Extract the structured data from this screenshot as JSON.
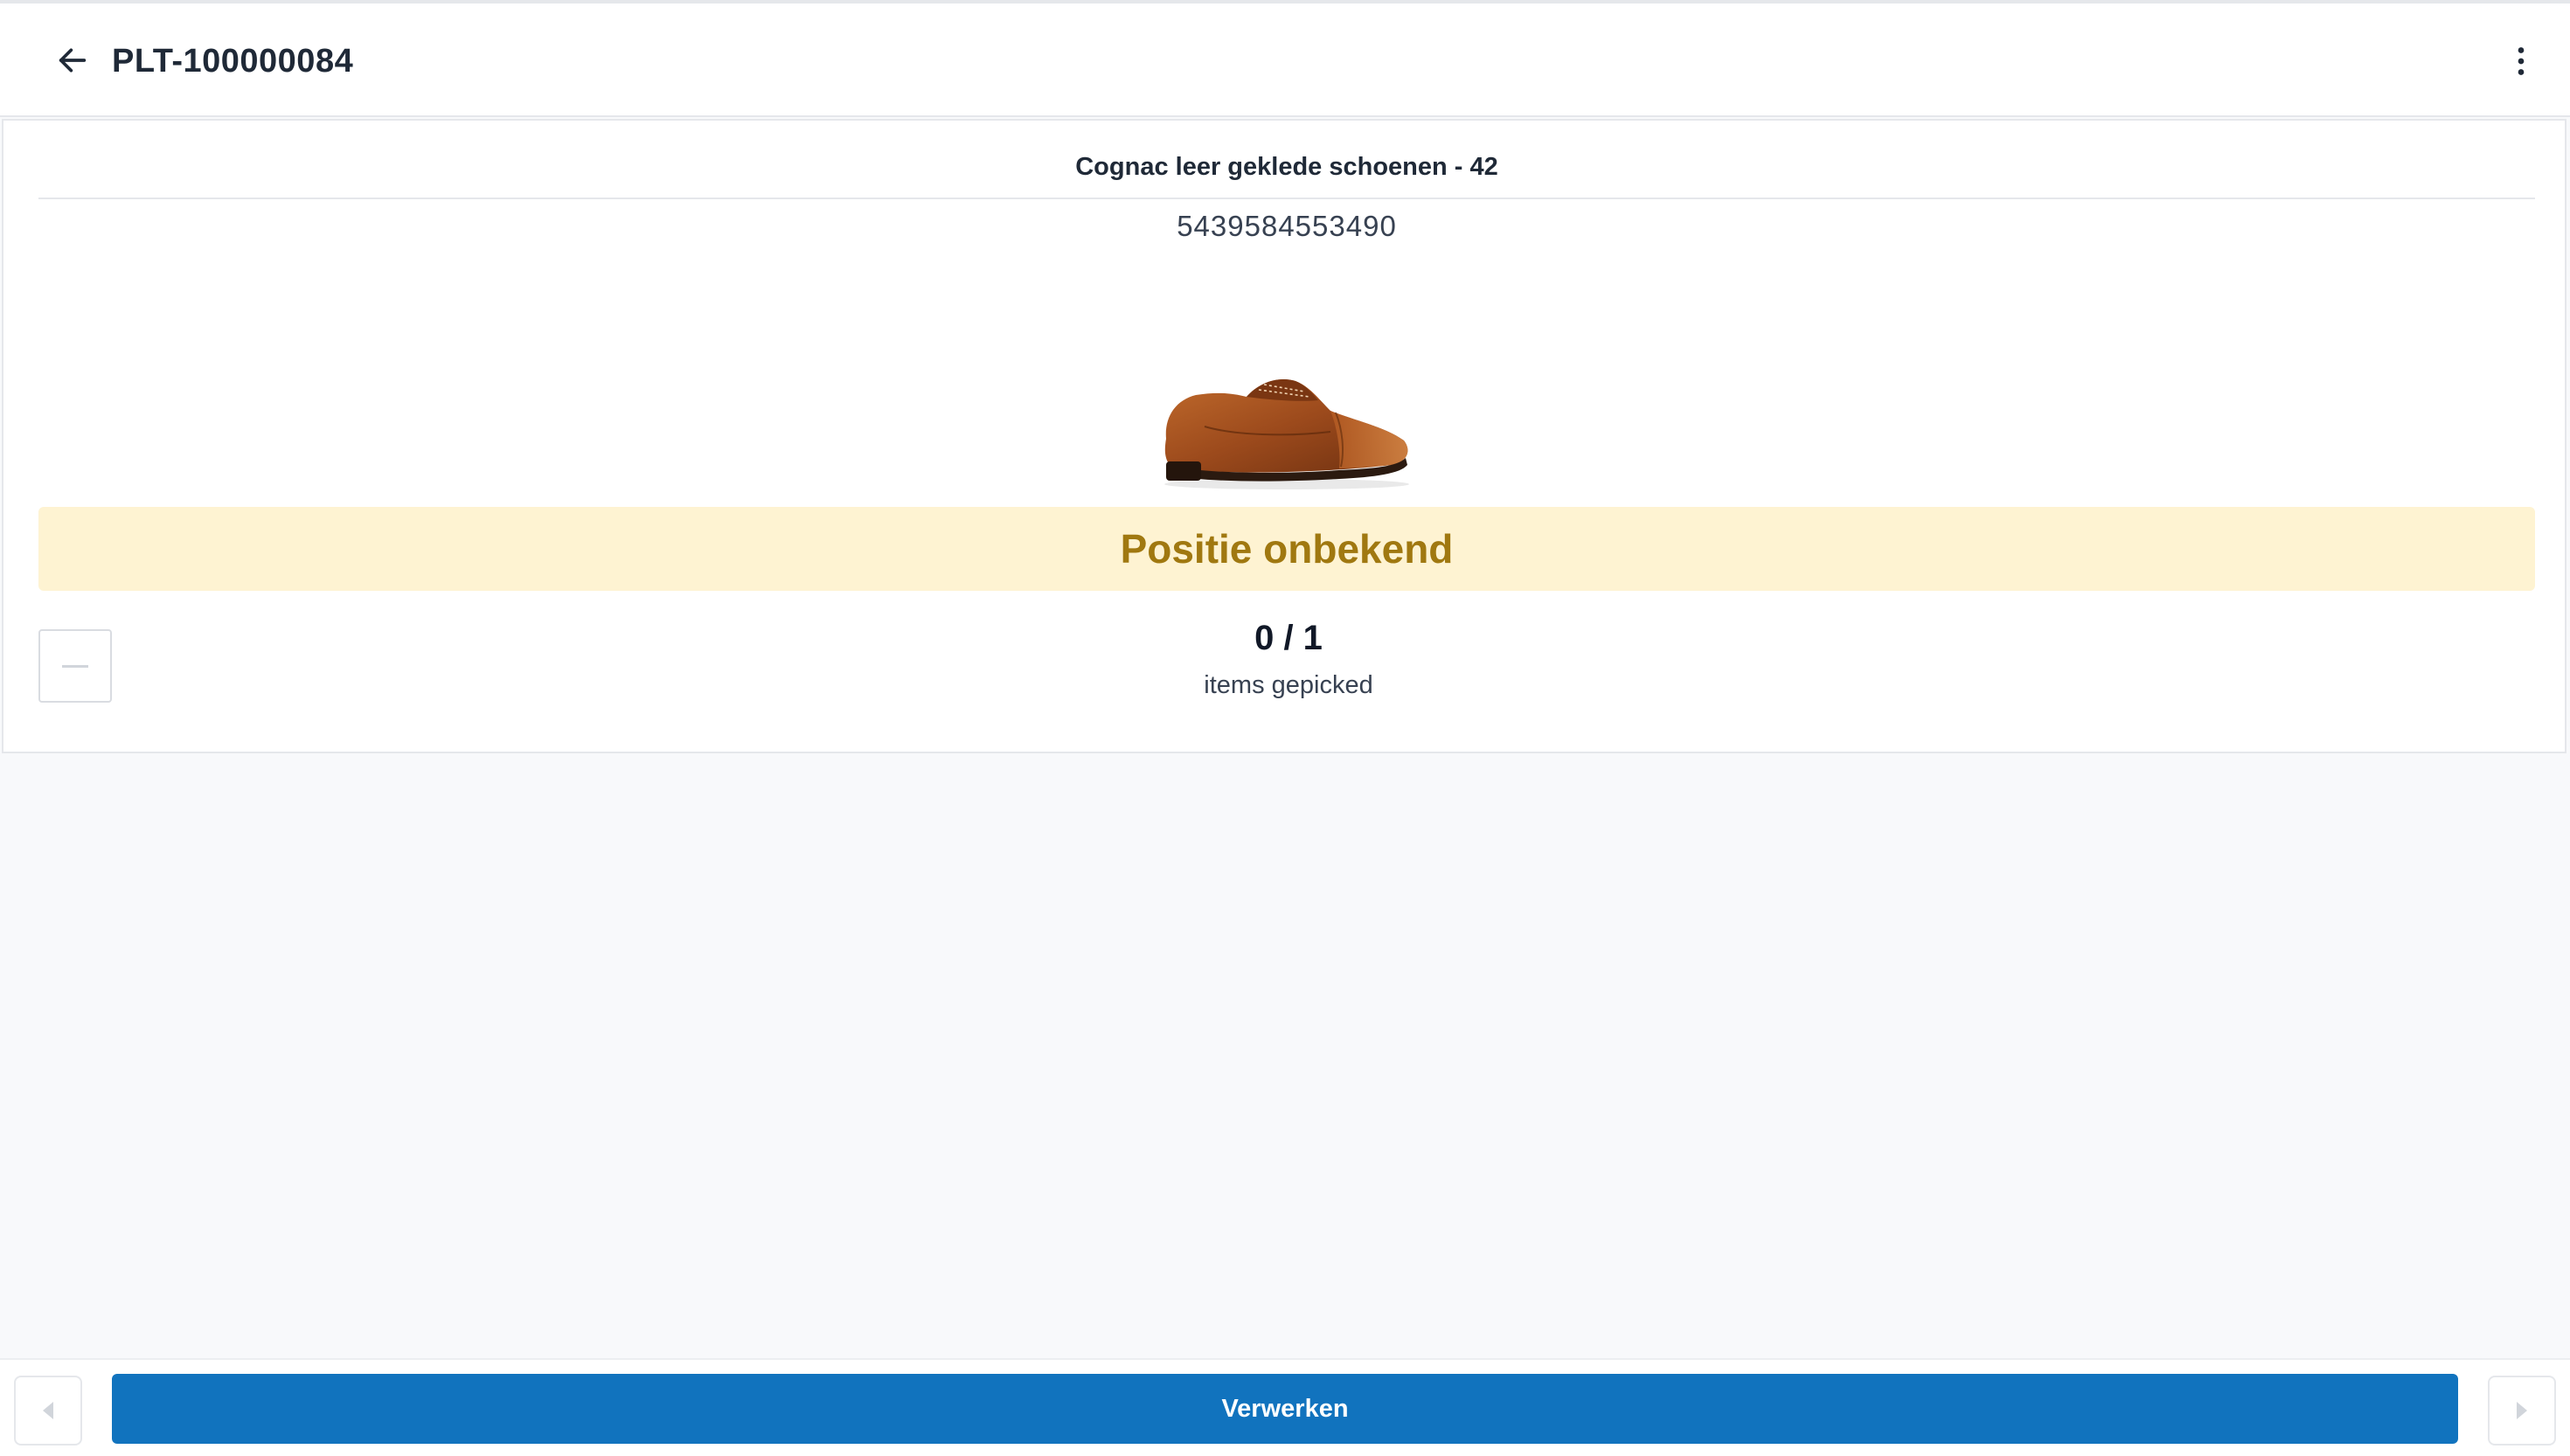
{
  "header": {
    "title": "PLT-100000084",
    "back_icon": "arrow-left-icon",
    "menu_icon": "more-vertical-icon"
  },
  "product": {
    "name": "Cognac leer geklede schoenen - 42",
    "barcode": "5439584553490",
    "image": "cognac-leather-oxford-shoe"
  },
  "position": {
    "label": "Positie onbekend"
  },
  "picking": {
    "count": "0 / 1",
    "label": "items gepicked",
    "decrement_icon": "minus-icon"
  },
  "footer": {
    "process_label": "Verwerken",
    "prev_icon": "caret-left-icon",
    "next_icon": "caret-right-icon"
  },
  "colors": {
    "primary": "#1173be",
    "warning_bg": "#fef3d2",
    "warning_text": "#a07810",
    "background": "#f8f9fb"
  }
}
